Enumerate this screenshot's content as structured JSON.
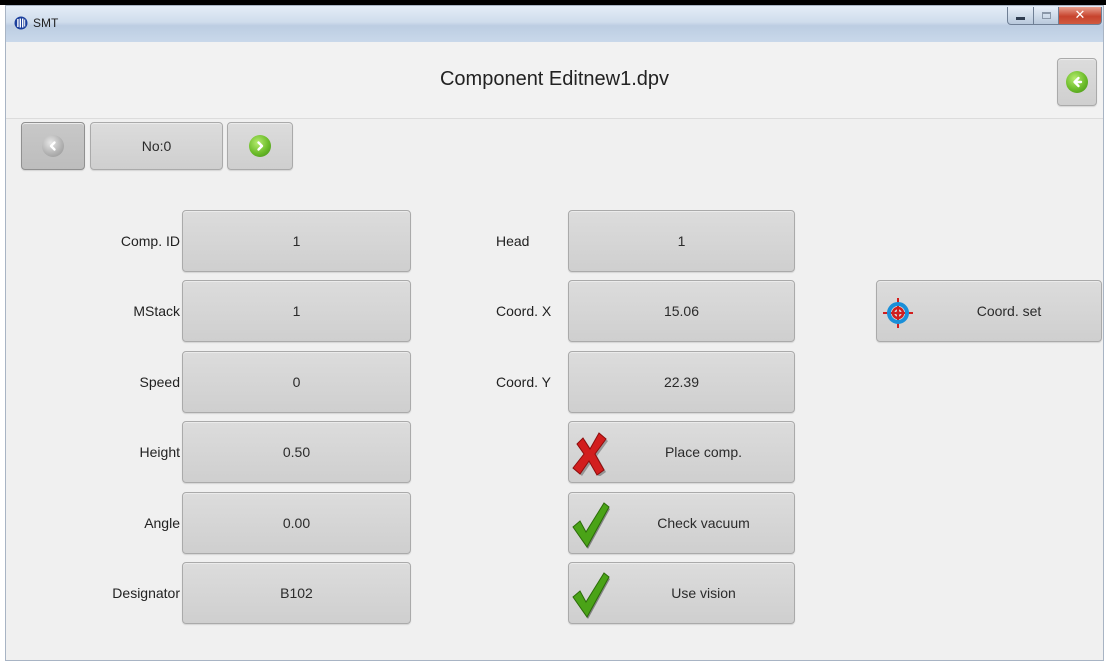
{
  "window": {
    "title": "SMT"
  },
  "header": {
    "title": "Component Editnew1.dpv"
  },
  "nav": {
    "number_label": "No:0"
  },
  "left_fields": [
    {
      "label": "Comp. ID",
      "value": "1"
    },
    {
      "label": "MStack",
      "value": "1"
    },
    {
      "label": "Speed",
      "value": "0"
    },
    {
      "label": "Height",
      "value": "0.50"
    },
    {
      "label": "Angle",
      "value": "0.00"
    },
    {
      "label": "Designator",
      "value": "B102"
    }
  ],
  "right_fields": [
    {
      "label": "Head",
      "value": "1"
    },
    {
      "label": "Coord. X",
      "value": "15.06"
    },
    {
      "label": "Coord. Y",
      "value": "22.39"
    }
  ],
  "toggles": [
    {
      "label": "Place comp.",
      "state": "off",
      "icon": "red-x-icon"
    },
    {
      "label": "Check vacuum",
      "state": "on",
      "icon": "green-check-icon"
    },
    {
      "label": "Use vision",
      "state": "on",
      "icon": "green-check-icon"
    }
  ],
  "coord_set": {
    "label": "Coord. set",
    "icon": "target-icon"
  },
  "colors": {
    "green": "#5aaa1e",
    "red": "#d21e1e",
    "button_grey": "#d4d4d4"
  }
}
